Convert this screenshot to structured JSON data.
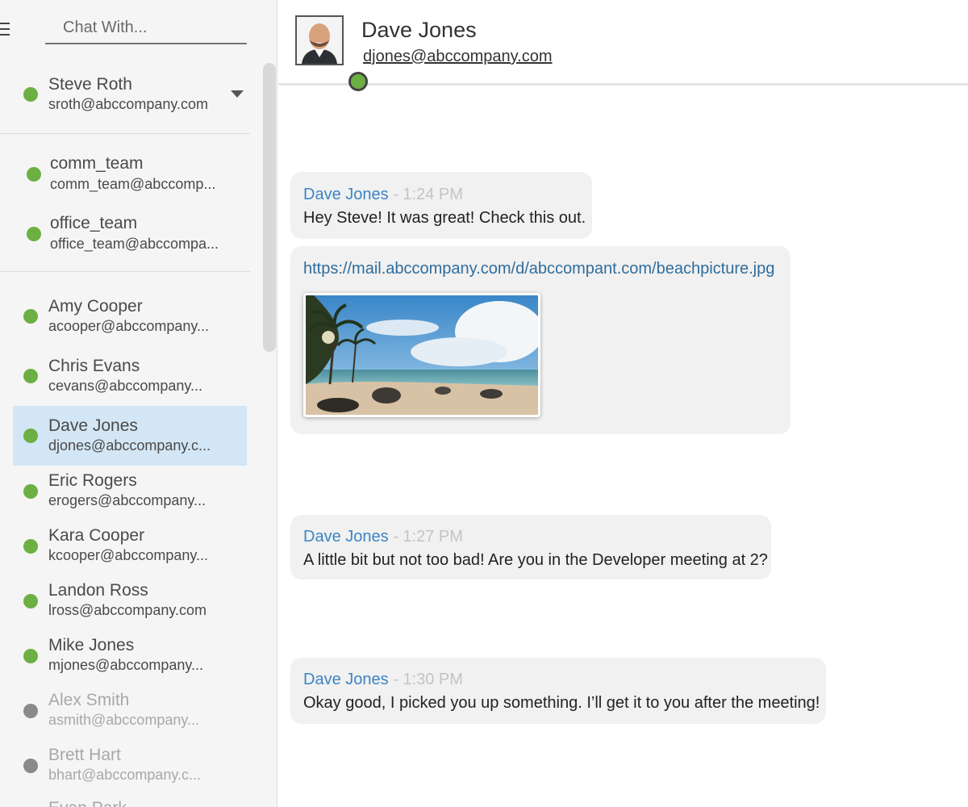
{
  "search": {
    "placeholder": "Chat With..."
  },
  "current_user": {
    "name": "Steve Roth",
    "email": "sroth@abccompany.com"
  },
  "groups": [
    {
      "name": "comm_team",
      "email": "comm_team@abccomp..."
    },
    {
      "name": "office_team",
      "email": "office_team@abccompa..."
    }
  ],
  "contacts": [
    {
      "name": "Amy Cooper",
      "email": "acooper@abccompany...",
      "status": "online"
    },
    {
      "name": "Chris Evans",
      "email": "cevans@abccompany...",
      "status": "online"
    },
    {
      "name": "Dave Jones",
      "email": "djones@abccompany.c...",
      "status": "online",
      "selected": true
    },
    {
      "name": "Eric Rogers",
      "email": "erogers@abccompany...",
      "status": "online"
    },
    {
      "name": "Kara Cooper",
      "email": "kcooper@abccompany...",
      "status": "online"
    },
    {
      "name": "Landon Ross",
      "email": "lross@abccompany.com",
      "status": "online"
    },
    {
      "name": "Mike Jones",
      "email": "mjones@abccompany...",
      "status": "online"
    },
    {
      "name": "Alex Smith",
      "email": "asmith@abccompany...",
      "status": "offline"
    },
    {
      "name": "Brett Hart",
      "email": "bhart@abccompany.c...",
      "status": "offline"
    },
    {
      "name": "Evan Park",
      "email": "",
      "status": "offline"
    }
  ],
  "chat_header": {
    "name": "Dave Jones",
    "email": "djones@abccompany.com",
    "status": "online"
  },
  "messages": [
    {
      "sender": "Dave Jones",
      "separator": "-",
      "time": "1:24 PM",
      "text": "Hey Steve!  It was great! Check this out."
    },
    {
      "link": "https://mail.abccompany.com/d/abccompant.com/beachpicture.jpg",
      "attachment": "beach photo"
    },
    {
      "sender": "Dave Jones",
      "separator": "-",
      "time": "1:27 PM",
      "text": "A little bit but not too bad!  Are you in the Developer meeting at 2?"
    },
    {
      "sender": "Dave Jones",
      "separator": "-",
      "time": "1:30 PM",
      "text": "Okay good, I picked you up something.  I’ll get it to you after the meeting!"
    }
  ],
  "colors": {
    "online": "#6cb043",
    "offline": "#8a8a8a",
    "sender": "#3d84c6",
    "link": "#2f6d9d",
    "selected": "#d3e6f5"
  },
  "icons": {
    "menu": "hamburger-icon",
    "dropdown": "caret-down-icon"
  }
}
